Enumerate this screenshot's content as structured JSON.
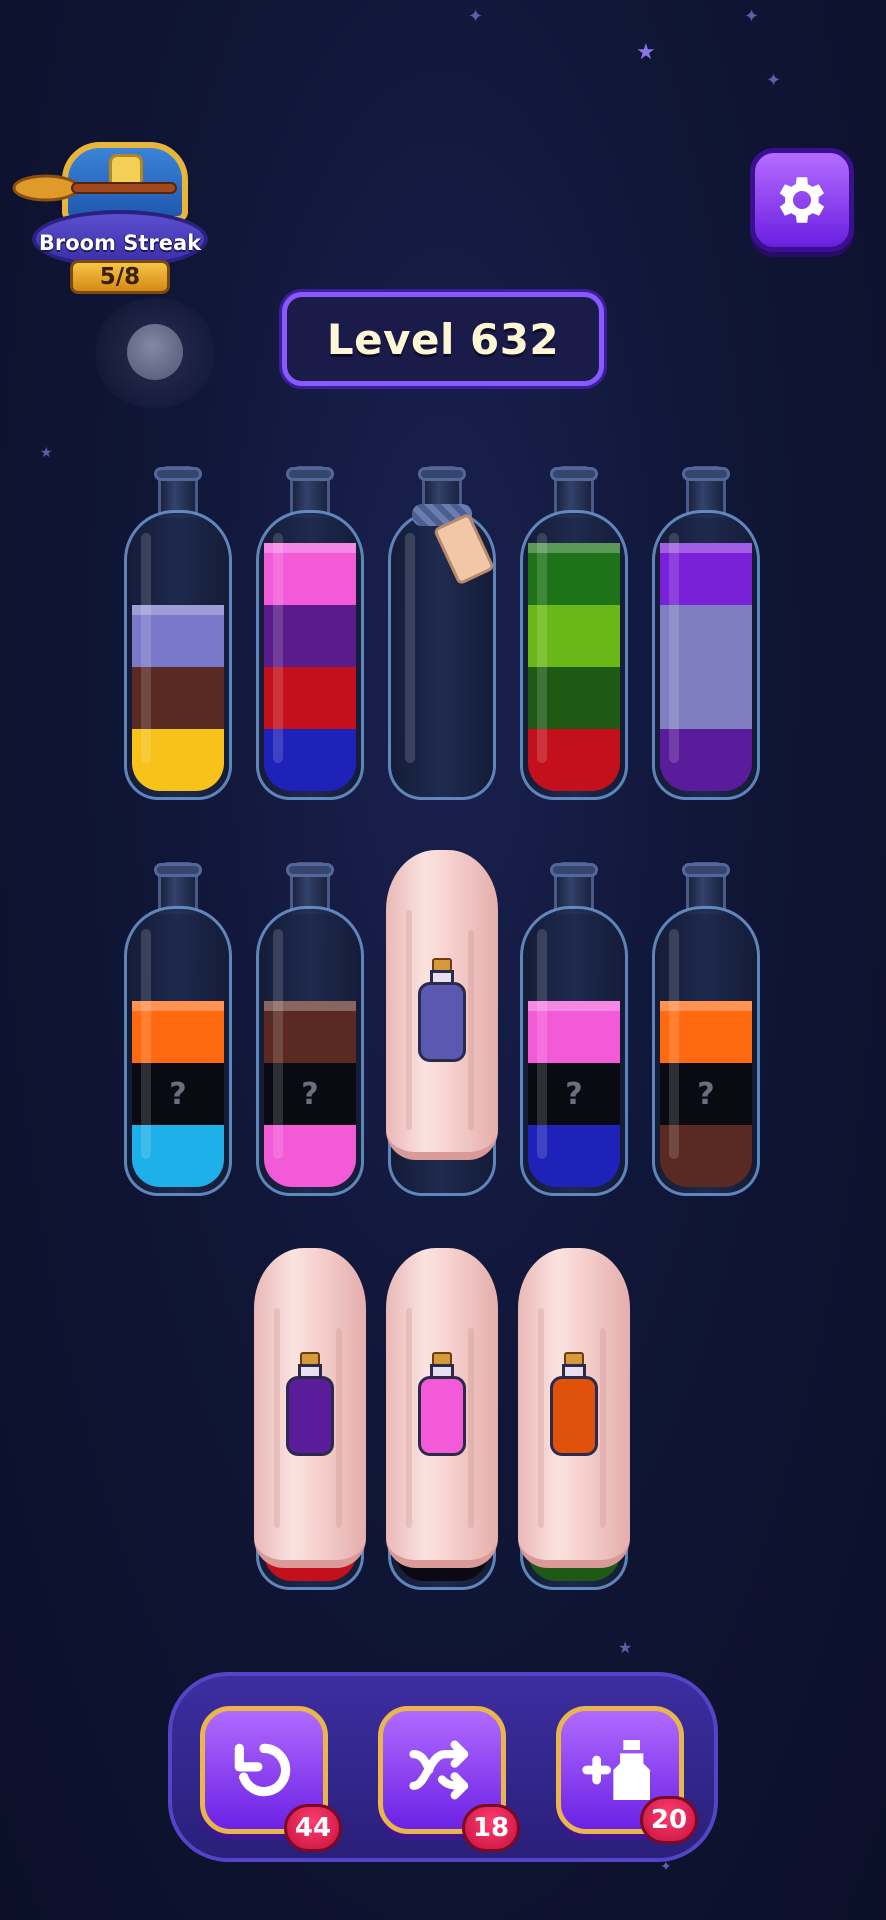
{
  "streak": {
    "label": "Broom Streak",
    "count": "5/8"
  },
  "level": {
    "label": "Level 632"
  },
  "settings": {
    "icon": "gear-icon"
  },
  "bottles_row1": [
    {
      "layers": [
        "#f7c21a",
        "#5a2a22",
        "#7a78c8"
      ]
    },
    {
      "layers": [
        "#1e22b8",
        "#c4101c",
        "#5a1c8a",
        "#f25ad8"
      ]
    },
    {
      "layers": [],
      "locked": true
    },
    {
      "layers": [
        "#c4101c",
        "#1e5a14",
        "#6ab818",
        "#1e7218"
      ]
    },
    {
      "layers": [
        "#5a1c9a",
        "#7e7ec0",
        "#7e7ec0",
        "#7a20d8"
      ]
    }
  ],
  "bottles_row2": [
    {
      "layers": [
        "#1eb0e8",
        "hidden",
        "#ff6a10"
      ]
    },
    {
      "layers": [
        "#f25ad8",
        "hidden",
        "#5a2a22"
      ]
    },
    {
      "covered": true,
      "potion": "#5a58b0"
    },
    {
      "layers": [
        "#1e22b8",
        "hidden",
        "#f25ad8"
      ]
    },
    {
      "layers": [
        "#5a2a22",
        "hidden",
        "#ff6a10"
      ]
    }
  ],
  "bottles_row3": [
    {
      "covered": true,
      "potion": "#5a1c9a",
      "base": "#c4101c"
    },
    {
      "covered": true,
      "potion": "#f25ad8",
      "base": "#0a0b12"
    },
    {
      "covered": true,
      "potion": "#e0520c",
      "base": "#1e5a14"
    }
  ],
  "hidden_mark": "?",
  "tools": {
    "undo_count": "44",
    "shuffle_count": "18",
    "add_bottle_count": "20"
  }
}
